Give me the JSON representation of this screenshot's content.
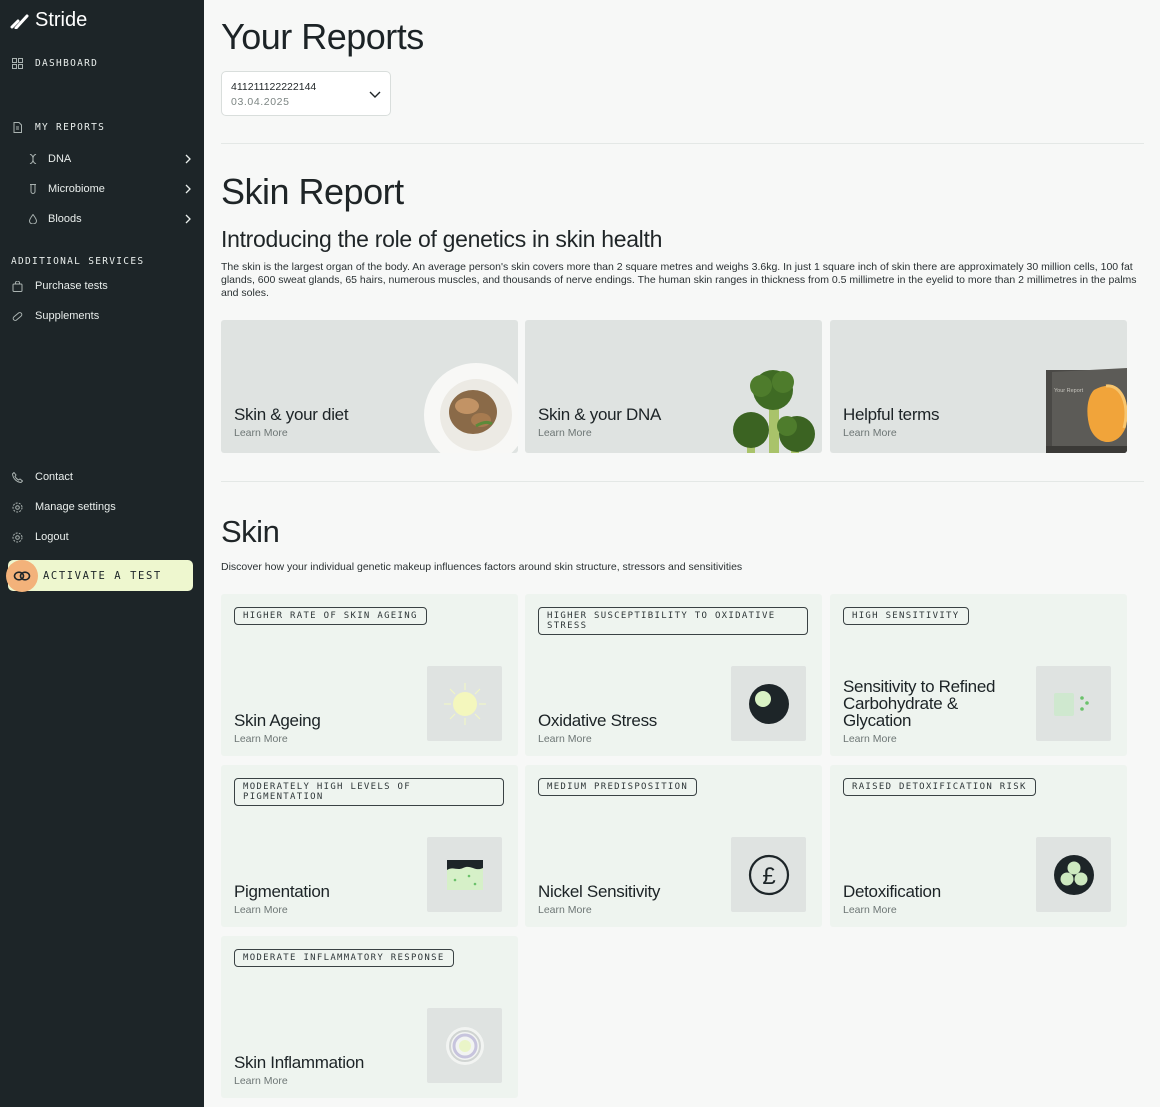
{
  "brand": {
    "name": "Stride"
  },
  "sidebar": {
    "dashboard": "DASHBOARD",
    "my_reports": "MY REPORTS",
    "reports": [
      {
        "label": "DNA",
        "icon": "dna-icon"
      },
      {
        "label": "Microbiome",
        "icon": "test-tube-icon"
      },
      {
        "label": "Bloods",
        "icon": "blood-drop-icon"
      }
    ],
    "additional_services": "ADDITIONAL SERVICES",
    "services": [
      {
        "label": "Purchase tests",
        "icon": "bag-icon"
      },
      {
        "label": "Supplements",
        "icon": "pill-icon"
      }
    ],
    "footer": [
      {
        "label": "Contact",
        "icon": "phone-icon"
      },
      {
        "label": "Manage settings",
        "icon": "gear-icon"
      },
      {
        "label": "Logout",
        "icon": "logout-icon"
      }
    ],
    "activate": "ACTIVATE A TEST"
  },
  "main": {
    "title": "Your Reports",
    "report_select": {
      "id": "411211122222144",
      "date": "03.04.2025"
    },
    "report_title": "Skin Report",
    "intro_heading": "Introducing the role of genetics in skin health",
    "intro_text": "The skin is the largest organ of the body. An average person's skin covers more than 2 square metres and weighs 3.6kg. In just 1 square inch of skin there are approximately 30 million cells, 100 fat glands, 600 sweat glands, 65 hairs, numerous muscles, and thousands of nerve endings. The human skin ranges in thickness from 0.5 millimetre in the eyelid to more than 2 millimetres in the palms and soles.",
    "hero_cards": [
      {
        "title": "Skin & your diet",
        "link": "Learn More"
      },
      {
        "title": "Skin & your DNA",
        "link": "Learn More"
      },
      {
        "title": "Helpful terms",
        "link": "Learn More",
        "image_text": "Your Report"
      }
    ],
    "section_title": "Skin",
    "section_text": "Discover how your individual genetic makeup influences factors around skin structure, stressors and sensitivities",
    "trait_cards": [
      {
        "tag": "HIGHER RATE OF SKIN AGEING",
        "title": "Skin Ageing",
        "link": "Learn More",
        "icon": "sun-icon"
      },
      {
        "tag": "HIGHER SUSCEPTIBILITY TO OXIDATIVE STRESS",
        "title": "Oxidative Stress",
        "link": "Learn More",
        "icon": "oxidation-icon"
      },
      {
        "tag": "HIGH SENSITIVITY",
        "title": "Sensitivity to Refined Carbohydrate & Glycation",
        "link": "Learn More",
        "icon": "sugar-cubes-icon"
      },
      {
        "tag": "MODERATELY HIGH LEVELS OF PIGMENTATION",
        "title": "Pigmentation",
        "link": "Learn More",
        "icon": "skin-layer-icon"
      },
      {
        "tag": "MEDIUM PREDISPOSITION",
        "title": "Nickel Sensitivity",
        "link": "Learn More",
        "icon": "pound-coin-icon"
      },
      {
        "tag": "RAISED DETOXIFICATION RISK",
        "title": "Detoxification",
        "link": "Learn More",
        "icon": "cells-icon"
      },
      {
        "tag": "MODERATE INFLAMMATORY RESPONSE",
        "title": "Skin Inflammation",
        "link": "Learn More",
        "icon": "target-rings-icon"
      }
    ]
  },
  "colors": {
    "sidebar_bg": "#1d2528",
    "accent": "#eef7cf",
    "badge": "#f3b27a",
    "card_bg": "#eef4ef",
    "lime": "#e8f5b8"
  }
}
